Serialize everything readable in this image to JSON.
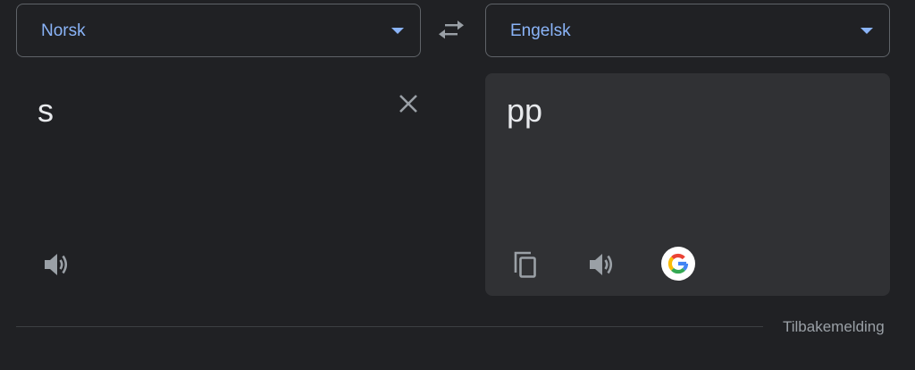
{
  "source_language": {
    "label": "Norsk"
  },
  "target_language": {
    "label": "Engelsk"
  },
  "source": {
    "text": "s"
  },
  "target": {
    "text": "pp"
  },
  "footer": {
    "feedback_label": "Tilbakemelding"
  },
  "colors": {
    "background": "#202124",
    "accent": "#8ab4f8",
    "panel": "#303134",
    "icon": "#9aa0a6",
    "text": "#e8eaed"
  },
  "icons": {
    "swap": "swap-arrows-icon",
    "clear": "close-icon",
    "listen": "speaker-icon",
    "copy": "copy-icon",
    "google": "google-logo-icon",
    "dropdown": "caret-down-icon"
  }
}
